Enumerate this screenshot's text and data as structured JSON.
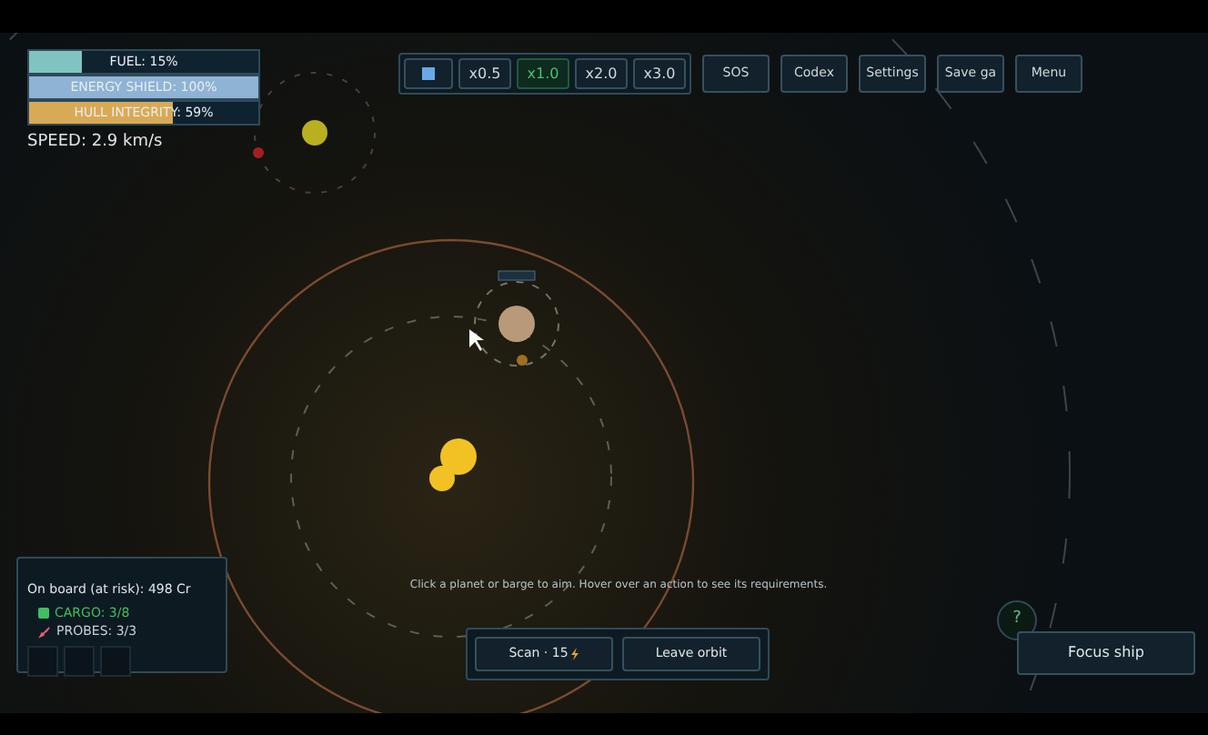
{
  "status_bars": [
    {
      "label": "FUEL: 15%",
      "level": 0.23,
      "color": "#7fc4c0"
    },
    {
      "label": "ENERGY SHIELD: 100%",
      "level": 1,
      "color": "#8fb3d4"
    },
    {
      "label": "HULL INTEGRITY: 59%",
      "level": 0.63,
      "color": "#d9aa55"
    }
  ],
  "speed": "SPEED: 2.9 km/s",
  "time_controls": [
    {
      "kind": "pause",
      "selected": false
    },
    {
      "kind": "speed",
      "label": "x0.5",
      "selected": false
    },
    {
      "kind": "speed",
      "label": "x1.0",
      "selected": true
    },
    {
      "kind": "speed",
      "label": "x2.0",
      "selected": false
    },
    {
      "kind": "speed",
      "label": "x3.0",
      "selected": false
    }
  ],
  "menu_buttons": [
    "SOS",
    "Codex",
    "Settings",
    "Save ga",
    "Menu"
  ],
  "cargo_panel": {
    "on_board": "On board (at risk): 498 Cr",
    "cargo": "CARGO: 3/8",
    "probes": "PROBES: 3/3"
  },
  "hint": "Click a planet or barge to aim. Hover over an action to see its requirements.",
  "actions": [
    {
      "label": "Scan · 15",
      "cost_icon": true
    },
    {
      "label": "Leave orbit",
      "cost_icon": false
    }
  ],
  "help_button": "?",
  "focus_button": "Focus ship"
}
